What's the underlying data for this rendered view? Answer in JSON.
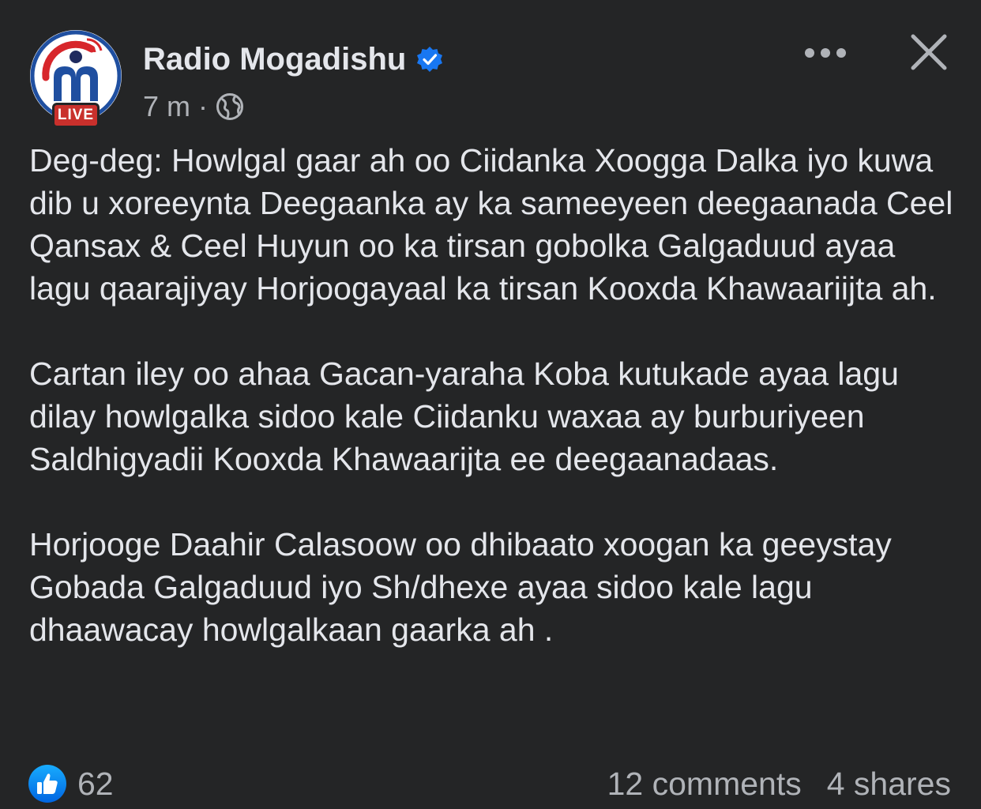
{
  "post": {
    "page_name": "Radio Mogadishu",
    "verified_icon": "verified-badge-icon",
    "time": "7 m",
    "separator": "·",
    "audience_icon": "globe-icon",
    "avatar_badge": "LIVE",
    "paragraphs": [
      "Deg-deg: Howlgal gaar ah oo Ciidanka Xoogga Dalka iyo kuwa dib u xoreeynta Deegaanka ay ka sameeyeen deegaanada Ceel Qansax & Ceel Huyun oo ka tirsan gobolka Galgaduud ayaa lagu qaarajiyay Horjoogayaal ka tirsan Kooxda Khawaariijta ah.",
      "Cartan iley oo ahaa Gacan-yaraha Koba kutukade ayaa lagu dilay howlgalka sidoo kale Ciidanku waxaa ay burburiyeen Saldhigyadii Kooxda Khawaarijta ee deegaanadaas.",
      "Horjooge Daahir Calasoow oo dhibaato xoogan ka geeystay Gobada Galgaduud iyo Sh/dhexe ayaa sidoo kale lagu dhaawacay howlgalkaan gaarka ah ."
    ]
  },
  "toolbar": {
    "more_icon": "more-options-icon",
    "close_icon": "close-icon"
  },
  "footer": {
    "like_icon": "like-thumb-icon",
    "like_count": "62",
    "comments": "12 comments",
    "shares": "4 shares"
  },
  "colors": {
    "background": "#242526",
    "text_primary": "#e4e6eb",
    "text_secondary": "#b0b3b8",
    "verified_blue": "#1877f2",
    "live_red": "#c9302c"
  }
}
